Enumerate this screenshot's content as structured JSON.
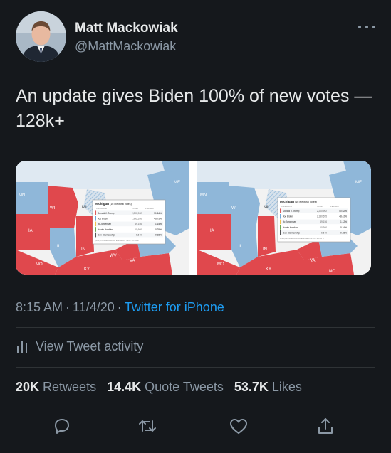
{
  "author": {
    "display_name": "Matt Mackowiak",
    "handle": "@MattMackowiak"
  },
  "tweet": {
    "text": "An update gives Biden 100% of new votes — 128k+",
    "time": "8:15 AM",
    "date": "11/4/20",
    "source": "Twitter for iPhone"
  },
  "media": {
    "left_map": {
      "state_labels": [
        "MN",
        "WI",
        "MI",
        "IA",
        "IL",
        "IN",
        "MO",
        "KY",
        "WV",
        "VA",
        "ME"
      ],
      "results_box": {
        "title": "Michigan",
        "subtitle": "(16 electoral votes)",
        "col_candidate": "CANDIDATE",
        "col_votes": "VOTES",
        "col_percent": "PERCENT",
        "rows": [
          {
            "name": "Donald J. Trump",
            "votes": "2,200,902",
            "pct": "51.64%",
            "color": "#e05a5a"
          },
          {
            "name": "Joe Biden",
            "votes": "1,992,356",
            "pct": "46.75%",
            "color": "#6fa8d8"
          },
          {
            "name": "Jo Jorgensen",
            "votes": "49,156",
            "pct": "1.15%",
            "color": "#f2c14e"
          },
          {
            "name": "Howie Hawkins",
            "votes": "10,600",
            "pct": "0.25%",
            "color": "#6aa84f"
          },
          {
            "name": "Don Blankenship",
            "votes": "6,549",
            "pct": "0.15%",
            "color": "#555555"
          }
        ],
        "footer": "4,261,379 votes counted. Estimated 77.3% - 80.5% in"
      }
    },
    "right_map": {
      "state_labels": [
        "MN",
        "WI",
        "MI",
        "IA",
        "IL",
        "IN",
        "MO",
        "KY",
        "VA",
        "NC",
        "ME"
      ],
      "results_box": {
        "title": "Michigan",
        "subtitle": "(16 electoral votes)",
        "col_candidate": "CANDIDATE",
        "col_votes": "VOTES",
        "col_percent": "PERCENT",
        "rows": [
          {
            "name": "Donald J. Trump",
            "votes": "2,200,902",
            "pct": "50.62%",
            "color": "#e05a5a"
          },
          {
            "name": "Joe Biden",
            "votes": "2,130,695",
            "pct": "48.42%",
            "color": "#6fa8d8"
          },
          {
            "name": "Jo Jorgensen",
            "votes": "49,156",
            "pct": "1.12%",
            "color": "#f2c14e"
          },
          {
            "name": "Howie Hawkins",
            "votes": "10,300",
            "pct": "0.24%",
            "color": "#6aa84f"
          },
          {
            "name": "Don Blankenship",
            "votes": "6,549",
            "pct": "0.15%",
            "color": "#555555"
          }
        ],
        "footer": "4,400,237 votes counted. Estimated 79.8% - 83.9% in"
      }
    },
    "colors": {
      "red": "#e0484d",
      "blue": "#8fb7d9",
      "hatch": "#c9d6e2",
      "land": "#f2f2f2"
    }
  },
  "activity_label": "View Tweet activity",
  "stats": [
    {
      "num": "20K",
      "label": "Retweets"
    },
    {
      "num": "14.4K",
      "label": "Quote Tweets"
    },
    {
      "num": "53.7K",
      "label": "Likes"
    }
  ],
  "actions": [
    "reply-icon",
    "retweet-icon",
    "like-icon",
    "share-icon"
  ],
  "colors": {
    "background": "#15181c",
    "text": "#e7e9ea",
    "muted": "#8b98a5",
    "link": "#1d9bf0",
    "divider": "#2f3336"
  }
}
